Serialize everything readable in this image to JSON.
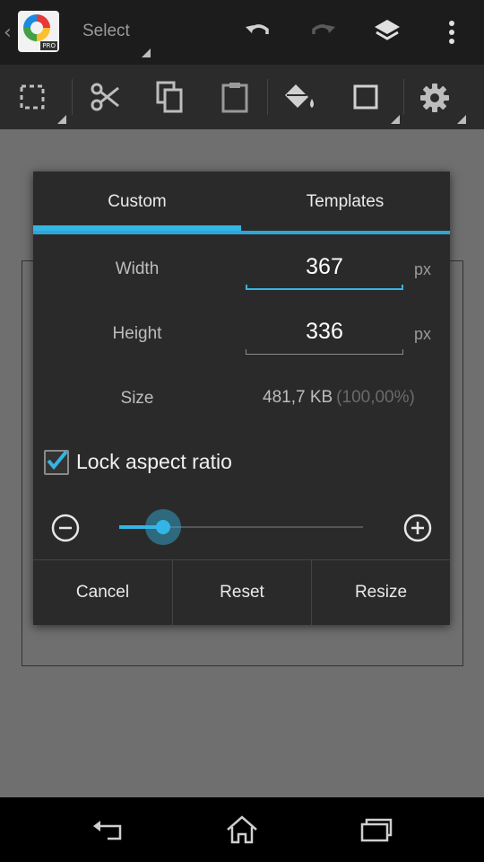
{
  "actionbar": {
    "select_label": "Select",
    "app_badge": "PRO",
    "icons": [
      "back-caret-icon",
      "app-logo-icon",
      "undo-icon",
      "redo-icon",
      "layers-icon",
      "overflow-menu-icon"
    ]
  },
  "toolbar": {
    "icons": [
      "selection-icon",
      "cut-icon",
      "copy-icon",
      "paste-icon",
      "fill-bucket-icon",
      "shape-icon",
      "settings-icon"
    ]
  },
  "dialog": {
    "tabs": [
      {
        "label": "Custom",
        "selected": true
      },
      {
        "label": "Templates",
        "selected": false
      }
    ],
    "width": {
      "label": "Width",
      "value": "367",
      "unit": "px"
    },
    "height": {
      "label": "Height",
      "value": "336",
      "unit": "px"
    },
    "size": {
      "label": "Size",
      "value": "481,7 KB",
      "percent": "(100,00%)"
    },
    "lock_aspect": {
      "label": "Lock aspect ratio",
      "checked": true
    },
    "zoom": {
      "level": 0.18
    },
    "buttons": {
      "cancel": "Cancel",
      "reset": "Reset",
      "resize": "Resize"
    }
  },
  "colors": {
    "accent": "#33b5e5",
    "dialog_bg": "#2a2a2a",
    "canvas_bg": "#6f6f6f"
  }
}
